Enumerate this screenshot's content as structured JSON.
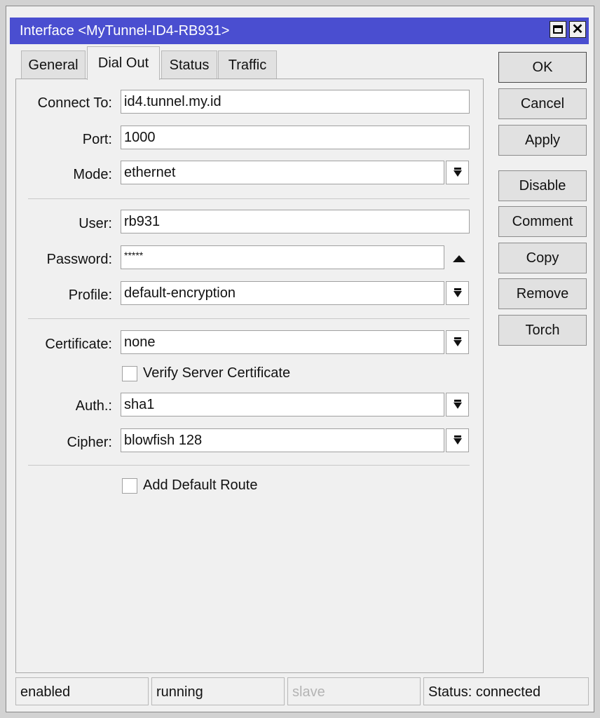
{
  "window": {
    "title": "Interface <MyTunnel-ID4-RB931>"
  },
  "tabs": [
    {
      "label": "General",
      "active": false
    },
    {
      "label": "Dial Out",
      "active": true
    },
    {
      "label": "Status",
      "active": false
    },
    {
      "label": "Traffic",
      "active": false
    }
  ],
  "form": {
    "connect_to": {
      "label": "Connect To:",
      "value": "id4.tunnel.my.id"
    },
    "port": {
      "label": "Port:",
      "value": "1000"
    },
    "mode": {
      "label": "Mode:",
      "value": "ethernet"
    },
    "user": {
      "label": "User:",
      "value": "rb931"
    },
    "password": {
      "label": "Password:",
      "value": "*****"
    },
    "profile": {
      "label": "Profile:",
      "value": "default-encryption"
    },
    "certificate": {
      "label": "Certificate:",
      "value": "none"
    },
    "verify_server_certificate": {
      "label": "Verify Server Certificate",
      "checked": false
    },
    "auth": {
      "label": "Auth.:",
      "value": "sha1"
    },
    "cipher": {
      "label": "Cipher:",
      "value": "blowfish 128"
    },
    "add_default_route": {
      "label": "Add Default Route",
      "checked": false
    }
  },
  "buttons": {
    "ok": "OK",
    "cancel": "Cancel",
    "apply": "Apply",
    "disable": "Disable",
    "comment": "Comment",
    "copy": "Copy",
    "remove": "Remove",
    "torch": "Torch"
  },
  "statusbar": {
    "enabled": "enabled",
    "running": "running",
    "slave": "slave",
    "status": "Status: connected"
  },
  "colors": {
    "titlebar": "#4a4ed0",
    "window_bg": "#f0f0f0"
  }
}
